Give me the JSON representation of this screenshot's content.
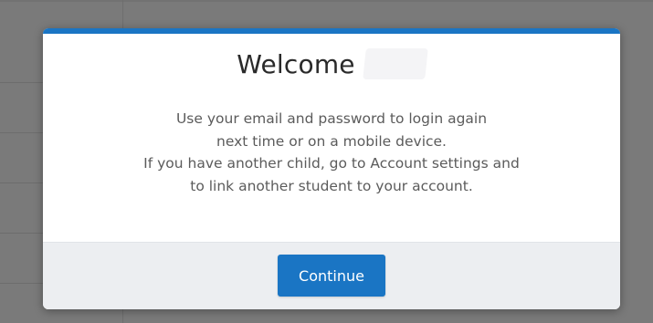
{
  "modal": {
    "title": "Welcome",
    "body_lines": [
      "Use your email and password to login again",
      "next time or on a mobile device.",
      "If you have another child, go to Account settings and",
      "to link another student to your account."
    ],
    "continue_label": "Continue"
  },
  "colors": {
    "accent": "#1a75c4",
    "footer_bg": "#eceef1",
    "overlay": "#7a7a7a"
  }
}
